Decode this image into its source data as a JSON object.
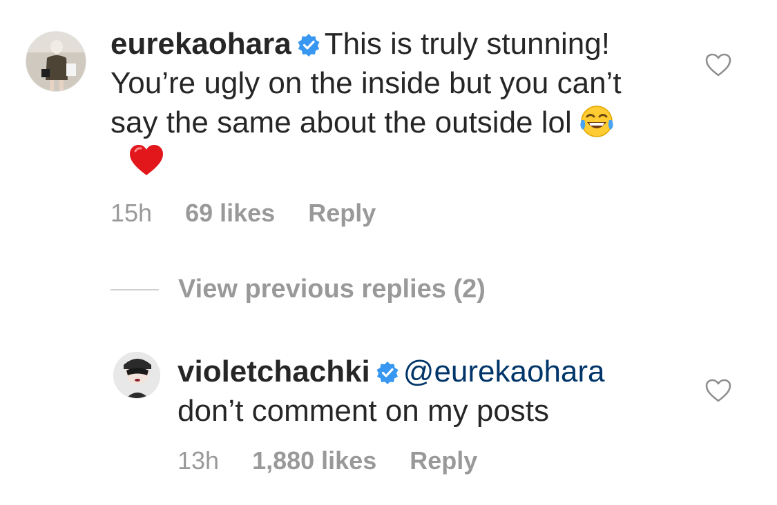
{
  "comments": [
    {
      "username": "eurekaohara",
      "text": "This is truly stunning! You’re ugly on the inside but you can’t say the same about the outside lol",
      "emojis": [
        "face-with-tears-of-joy",
        "red-heart"
      ],
      "time": "15h",
      "likes": "69 likes",
      "reply_label": "Reply",
      "verified": true
    }
  ],
  "view_previous_replies": "View previous replies (2)",
  "replies": [
    {
      "username": "violetchachki",
      "mention": "@eurekaohara",
      "text": "don’t comment on my posts",
      "time": "13h",
      "likes": "1,880 likes",
      "reply_label": "Reply",
      "verified": true
    }
  ],
  "colors": {
    "text": "#262626",
    "secondary": "#999999",
    "mention": "#003569",
    "verified_badge": "#3897f0"
  }
}
